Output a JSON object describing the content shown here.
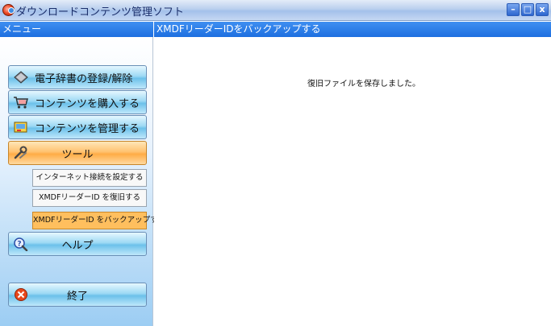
{
  "window": {
    "title": "ダウンロードコンテンツ管理ソフト",
    "buttons": [
      "–",
      "□",
      "x"
    ]
  },
  "menu": {
    "header": "メニュー",
    "items": [
      {
        "label": "電子辞書の登録/解除",
        "icon": "dictionary-icon"
      },
      {
        "label": "コンテンツを購入する",
        "icon": "cart-icon"
      },
      {
        "label": "コンテンツを管理する",
        "icon": "folder-icon"
      },
      {
        "label": "ツール",
        "icon": "tools-icon",
        "active": true
      },
      {
        "label": "ヘルプ",
        "icon": "help-icon"
      },
      {
        "label": "終了",
        "icon": "exit-icon"
      }
    ],
    "tool_subitems": [
      {
        "label": "インターネット接続を設定する"
      },
      {
        "label": "XMDFリーダーID を復旧する"
      },
      {
        "label": "XMDFリーダーID をバックアップする",
        "active": true
      }
    ]
  },
  "content": {
    "header": "XMDFリーダーIDをバックアップする",
    "message": "復旧ファイルを保存しました。"
  },
  "colors": {
    "header_blue": "#1d6fe0",
    "menu_button": "#6cc1ea",
    "active_orange": "#ffac45"
  }
}
